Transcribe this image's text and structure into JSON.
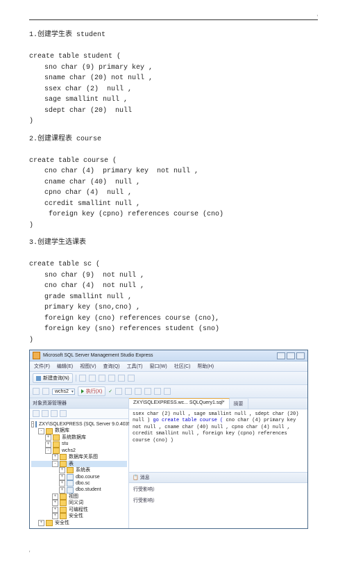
{
  "sections": {
    "s1_title": "1.创建学生表 student",
    "s1_lines": {
      "l0": "create table student (",
      "l1": "sno char (9) primary key ,",
      "l2": "sname char (20) not null ,",
      "l3": "ssex char (2)  null ,",
      "l4": "sage smallint null ,",
      "l5": "sdept char (20)  null",
      "l6": ")"
    },
    "s2_title": "2.创建课程表 course",
    "s2_lines": {
      "l0": "create table course (",
      "l1": "cno char (4)  primary key  not null ,",
      "l2": "cname char (40)  null ,",
      "l3": "cpno char (4)  null ,",
      "l4": "ccredit smallint null ,",
      "l5": " foreign key (cpno) references course (cno)",
      "l6": ")"
    },
    "s3_title": "3.创建学生选课表",
    "s3_lines": {
      "l0": "create table sc (",
      "l1": "sno char (9)  not null ,",
      "l2": "cno char (4)  not null ,",
      "l3": "grade smallint null ,",
      "l4": "primary key (sno,cno) ,",
      "l5": "foreign key (cno) references course (cno),",
      "l6": "foreign key (sno) references student (sno)",
      "l7": ")"
    }
  },
  "ssms": {
    "title": "Microsoft SQL Server Management Studio Express",
    "menu": {
      "file": "文件(F)",
      "edit": "编辑(E)",
      "view": "视图(V)",
      "query": "查询(Q)",
      "tools": "工具(T)",
      "window": "窗口(W)",
      "community": "社区(C)",
      "help": "帮助(H)"
    },
    "toolbar": {
      "newquery": "新建查询(N)"
    },
    "toolbar2": {
      "db": "wchs2",
      "exec": "执行(X)"
    },
    "objexp": {
      "header": "对象资源管理器",
      "server": "ZXY\\SQLEXPRESS (SQL Server 9.0.4035 - ",
      "dbs": "数据库",
      "sysdb": "系统数据库",
      "stu": "stu",
      "wchs2": "wchs2",
      "diagrams": "数据库关系图",
      "tables": "表",
      "systables": "系统表",
      "t_course": "dbo.course",
      "t_sc": "dbo.sc",
      "t_student": "dbo.student",
      "views": "视图",
      "synonyms": "同义词",
      "programmability": "可编程性",
      "security": "安全性",
      "serversec": "安全性"
    },
    "tabs": {
      "tab1": "ZXY\\SQLEXPRESS.wc... SQLQuery1.sql*",
      "tab2": "摘要"
    },
    "editor": {
      "c1": "    ssex char (2)  null ,",
      "c2": "    sage smallint null ,",
      "c3": "    sdept char (20)  null",
      "c4": ")",
      "c5": "go",
      "c6": "create table course (",
      "c7": "    cno char (4)  primary key  not null ,",
      "c8": "    cname char (40)  null ,",
      "c9": "    cpno char (4)  null ,",
      "c10": "    ccredit smallint null ,",
      "c11": "    foreign key (cpno) references course (cno)",
      "c12": ")"
    },
    "results": {
      "tab": "消息",
      "line1": "行受影响）",
      "line2": "行受影响）"
    }
  },
  "footer_dot": "'"
}
